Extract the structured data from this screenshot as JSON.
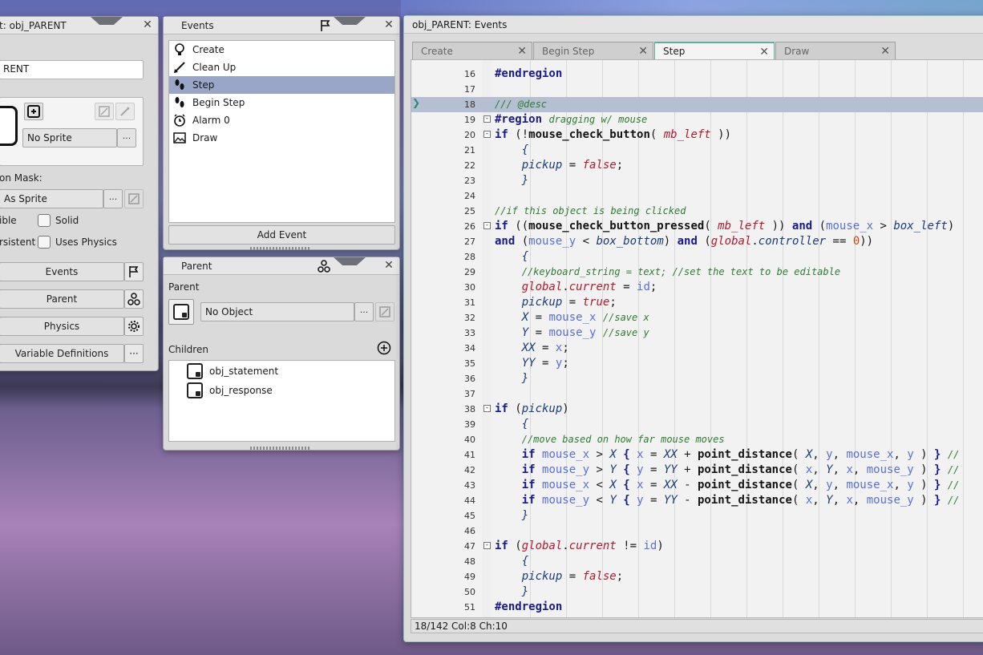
{
  "object_panel": {
    "title": "t: obj_PARENT",
    "name_value": "RENT",
    "sprite_value": "No Sprite",
    "collision_mask_label": "on Mask:",
    "collision_mask_value": "As Sprite",
    "visible_label": "ible",
    "solid_label": "Solid",
    "persistent_label": "rsistent",
    "uses_physics_label": "Uses Physics",
    "buttons": {
      "events": "Events",
      "parent": "Parent",
      "physics": "Physics",
      "variable_definitions": "Variable Definitions"
    },
    "ellipsis": "···"
  },
  "events_panel": {
    "title": "Events",
    "items": [
      {
        "label": "Create",
        "icon": "lightbulb-icon"
      },
      {
        "label": "Clean Up",
        "icon": "broom-icon"
      },
      {
        "label": "Step",
        "icon": "footsteps-icon"
      },
      {
        "label": "Begin Step",
        "icon": "footsteps-icon"
      },
      {
        "label": "Alarm 0",
        "icon": "alarm-clock-icon"
      },
      {
        "label": "Draw",
        "icon": "picture-icon"
      }
    ],
    "selected_index": 2,
    "add_event_label": "Add Event"
  },
  "parent_panel": {
    "title": "Parent",
    "parent_label": "Parent",
    "parent_value": "No Object",
    "children_label": "Children",
    "children": [
      "obj_statement",
      "obj_response"
    ]
  },
  "editor": {
    "title": "obj_PARENT: Events",
    "tabs": [
      {
        "label": "Create",
        "active": false
      },
      {
        "label": "Begin Step",
        "active": false
      },
      {
        "label": "Step",
        "active": true
      },
      {
        "label": "Draw",
        "active": false
      }
    ],
    "status": "18/142 Col:8 Ch:10",
    "current_line": 18,
    "lines": [
      {
        "n": 16,
        "fold": "",
        "html": "<span class='reg'>#endregion</span>"
      },
      {
        "n": 17,
        "fold": "",
        "html": ""
      },
      {
        "n": 18,
        "fold": "",
        "html": "<span class='cmt'>/// @desc</span>"
      },
      {
        "n": 19,
        "fold": "-",
        "html": "<span class='reg'>#region</span> <span class='cmt'>dragging w/ mouse</span>"
      },
      {
        "n": 20,
        "fold": "-",
        "html": "<span class='kw'>if</span> (!<span class='fn'>mouse_check_button</span>( <span class='const'>mb_left</span> ))"
      },
      {
        "n": 21,
        "fold": "",
        "html": "    <span class='var'>{</span>"
      },
      {
        "n": 22,
        "fold": "",
        "html": "    <span class='var'>pickup</span> = <span class='const'>false</span>;"
      },
      {
        "n": 23,
        "fold": "",
        "html": "    <span class='var'>}</span>"
      },
      {
        "n": 24,
        "fold": "",
        "html": ""
      },
      {
        "n": 25,
        "fold": "",
        "html": "<span class='cmt'>//if this object is being clicked</span>"
      },
      {
        "n": 26,
        "fold": "-",
        "html": "<span class='kw'>if</span> ((<span class='fn'>mouse_check_button_pressed</span>( <span class='const'>mb_left</span> )) <span class='kw'>and</span> (<span class='bi'>mouse_x</span> &gt; <span class='var'>box_left</span>)"
      },
      {
        "n": 27,
        "fold": "",
        "html": "<span class='kw'>and</span> (<span class='bi'>mouse_y</span> &lt; <span class='var'>box_bottom</span>) <span class='kw'>and</span> (<span class='const'>global</span>.<span class='var'>controller</span> == <span class='num'>0</span>))"
      },
      {
        "n": 28,
        "fold": "",
        "html": "    <span class='var'>{</span>"
      },
      {
        "n": 29,
        "fold": "",
        "html": "    <span class='cmt'>//keyboard_string = text; //set the text to be editable</span>"
      },
      {
        "n": 30,
        "fold": "",
        "html": "    <span class='const'>global</span>.<span class='const'>current</span> = <span class='bi'>id</span>;"
      },
      {
        "n": 31,
        "fold": "",
        "html": "    <span class='var'>pickup</span> = <span class='const'>true</span>;"
      },
      {
        "n": 32,
        "fold": "",
        "html": "    <span class='var'>X</span> = <span class='bi'>mouse_x</span> <span class='cmt'>//save x</span>"
      },
      {
        "n": 33,
        "fold": "",
        "html": "    <span class='var'>Y</span> = <span class='bi'>mouse_y</span> <span class='cmt'>//save y</span>"
      },
      {
        "n": 34,
        "fold": "",
        "html": "    <span class='var'>XX</span> = <span class='bi'>x</span>;"
      },
      {
        "n": 35,
        "fold": "",
        "html": "    <span class='var'>YY</span> = <span class='bi'>y</span>;"
      },
      {
        "n": 36,
        "fold": "",
        "html": "    <span class='var'>}</span>"
      },
      {
        "n": 37,
        "fold": "",
        "html": ""
      },
      {
        "n": 38,
        "fold": "-",
        "html": "<span class='kw'>if</span> (<span class='var'>pickup</span>)"
      },
      {
        "n": 39,
        "fold": "",
        "html": "    <span class='var'>{</span>"
      },
      {
        "n": 40,
        "fold": "",
        "html": "    <span class='cmt'>//move based on how far mouse moves</span>"
      },
      {
        "n": 41,
        "fold": "",
        "html": "    <span class='kw'>if</span> <span class='bi'>mouse_x</span> &gt; <span class='var'>X</span> <span class='kw'>{</span> <span class='bi'>x</span> = <span class='var'>XX</span> + <span class='fn'>point_distance</span>( <span class='var'>X</span>, <span class='bi'>y</span>, <span class='bi'>mouse_x</span>, <span class='bi'>y</span> ) <span class='kw'>}</span> <span class='cmt'>//</span>"
      },
      {
        "n": 42,
        "fold": "",
        "html": "    <span class='kw'>if</span> <span class='bi'>mouse_y</span> &gt; <span class='var'>Y</span> <span class='kw'>{</span> <span class='bi'>y</span> = <span class='var'>YY</span> + <span class='fn'>point_distance</span>( <span class='bi'>x</span>, <span class='var'>Y</span>, <span class='bi'>x</span>, <span class='bi'>mouse_y</span> ) <span class='kw'>}</span> <span class='cmt'>//</span>"
      },
      {
        "n": 43,
        "fold": "",
        "html": "    <span class='kw'>if</span> <span class='bi'>mouse_x</span> &lt; <span class='var'>X</span> <span class='kw'>{</span> <span class='bi'>x</span> = <span class='var'>XX</span> - <span class='fn'>point_distance</span>( <span class='var'>X</span>, <span class='bi'>y</span>, <span class='bi'>mouse_x</span>, <span class='bi'>y</span> ) <span class='kw'>}</span> <span class='cmt'>//</span>"
      },
      {
        "n": 44,
        "fold": "",
        "html": "    <span class='kw'>if</span> <span class='bi'>mouse_y</span> &lt; <span class='var'>Y</span> <span class='kw'>{</span> <span class='bi'>y</span> = <span class='var'>YY</span> - <span class='fn'>point_distance</span>( <span class='bi'>x</span>, <span class='var'>Y</span>, <span class='bi'>x</span>, <span class='bi'>mouse_y</span> ) <span class='kw'>}</span> <span class='cmt'>//</span>"
      },
      {
        "n": 45,
        "fold": "",
        "html": "    <span class='var'>}</span>"
      },
      {
        "n": 46,
        "fold": "",
        "html": ""
      },
      {
        "n": 47,
        "fold": "-",
        "html": "<span class='kw'>if</span> (<span class='const'>global</span>.<span class='const'>current</span> != <span class='bi'>id</span>)"
      },
      {
        "n": 48,
        "fold": "",
        "html": "    <span class='var'>{</span>"
      },
      {
        "n": 49,
        "fold": "",
        "html": "    <span class='var'>pickup</span> = <span class='const'>false</span>;"
      },
      {
        "n": 50,
        "fold": "",
        "html": "    <span class='var'>}</span>"
      },
      {
        "n": 51,
        "fold": "",
        "html": "<span class='reg'>#endregion</span>"
      }
    ]
  }
}
